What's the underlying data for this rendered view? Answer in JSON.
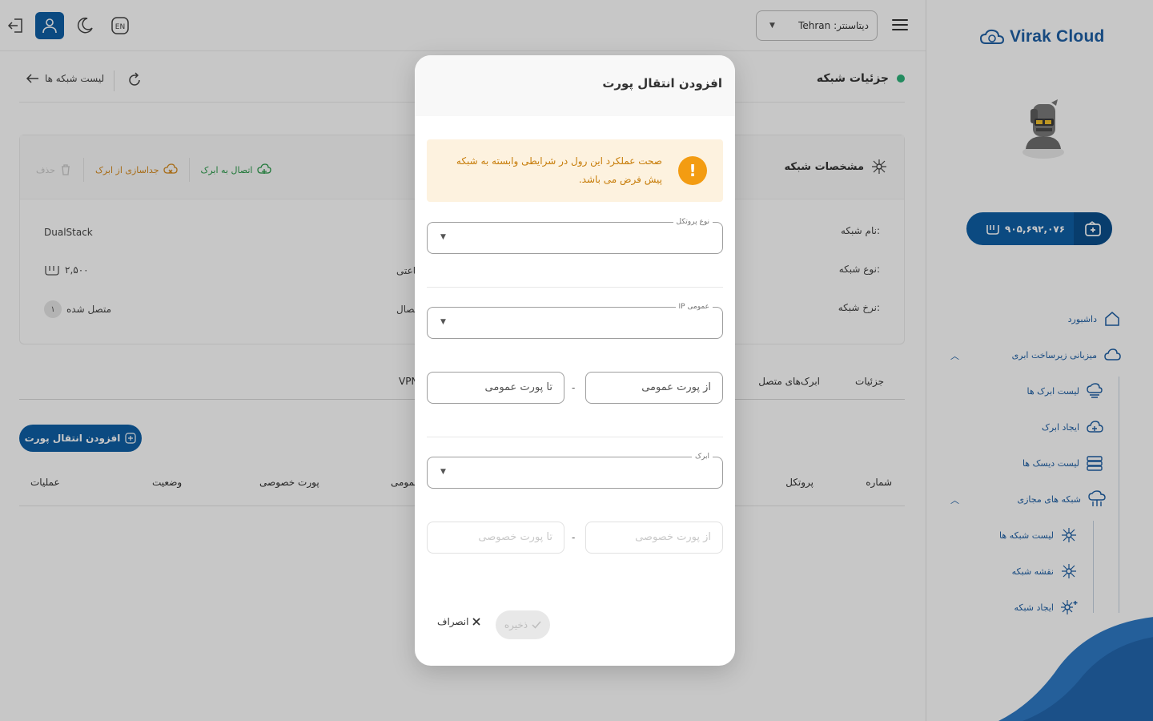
{
  "brand": {
    "name": "Virak Cloud"
  },
  "wallet": {
    "amount": "۹۰۵,۶۹۲,۰۷۶"
  },
  "sidebar": {
    "items": [
      {
        "label": "داشبورد"
      },
      {
        "label": "میزبانی زیرساخت ابری"
      },
      {
        "label": "لیست ابرک ها"
      },
      {
        "label": "ایجاد ابرک"
      },
      {
        "label": "لیست دیسک ها"
      },
      {
        "label": "شبکه های مجازی"
      },
      {
        "label": "لیست شبکه ها"
      },
      {
        "label": "نقشه شبکه"
      },
      {
        "label": "ایجاد شبکه"
      }
    ]
  },
  "topbar": {
    "datacenter": "دیتاسنتر: Tehran",
    "lang": "EN"
  },
  "page": {
    "title": "جزئیات شبکه",
    "back": "لیست شبکه ها"
  },
  "spec": {
    "title": "مشخصات شبکه",
    "actions": {
      "connect": "اتصال به ابرک",
      "detach": "جداسازی از ابرک",
      "delete": "حذف"
    },
    "rows": {
      "name_label": "نام شبکه:",
      "type_label": "نوع شبکه:",
      "type_value": "DualStack",
      "rate_label": "نرخ شبکه:",
      "rate_value": "۲,۵۰۰",
      "hourly_label": "ساعتی:",
      "conn_label": "اتصال:",
      "conn_value": "متصل شده",
      "conn_count": "۱"
    }
  },
  "tabs": [
    {
      "label": "جزئیات"
    },
    {
      "label": "ابرک‌های متصل"
    },
    {
      "label": "VPN"
    }
  ],
  "table": {
    "add_button": "افزودن انتقال پورت",
    "columns": [
      "شماره",
      "پروتکل",
      "عمومی",
      "پورت خصوصی",
      "وضعیت",
      "عملیات"
    ]
  },
  "modal": {
    "title": "افزودن انتقال پورت",
    "alert": "صحت عملکرد این رول در شرایطی وابسته به شبکه پیش فرض می باشد.",
    "protocol_label": "نوع پروتکل",
    "public_ip_label": "IP عمومی",
    "from_public_port": "از پورت عمومی",
    "to_public_port": "تا پورت عمومی",
    "instance_label": "ابرک",
    "from_private_port": "از پورت خصوصی",
    "to_private_port": "تا پورت خصوصی",
    "range_sep": "-",
    "save": "ذخیره",
    "cancel": "انصراف"
  },
  "colors": {
    "primary": "#0f5fa6",
    "success": "#2db37a",
    "warning": "#f39c12",
    "alert_bg": "#fdf2df"
  }
}
